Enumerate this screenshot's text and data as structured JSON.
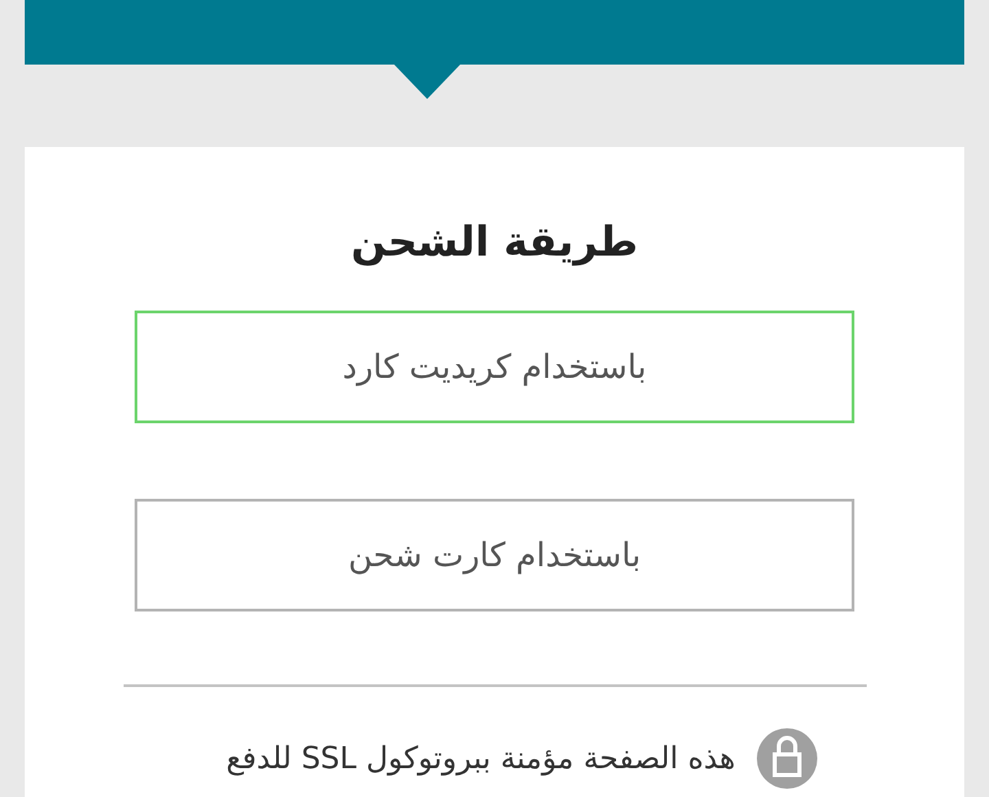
{
  "section": {
    "title": "طريقة الشحن"
  },
  "options": [
    {
      "label": "باستخدام كريديت كارد",
      "selected": true
    },
    {
      "label": "باستخدام كارت شحن",
      "selected": false
    }
  ],
  "security_note": "هذه الصفحة مؤمنة ببروتوكول SSL للدفع"
}
